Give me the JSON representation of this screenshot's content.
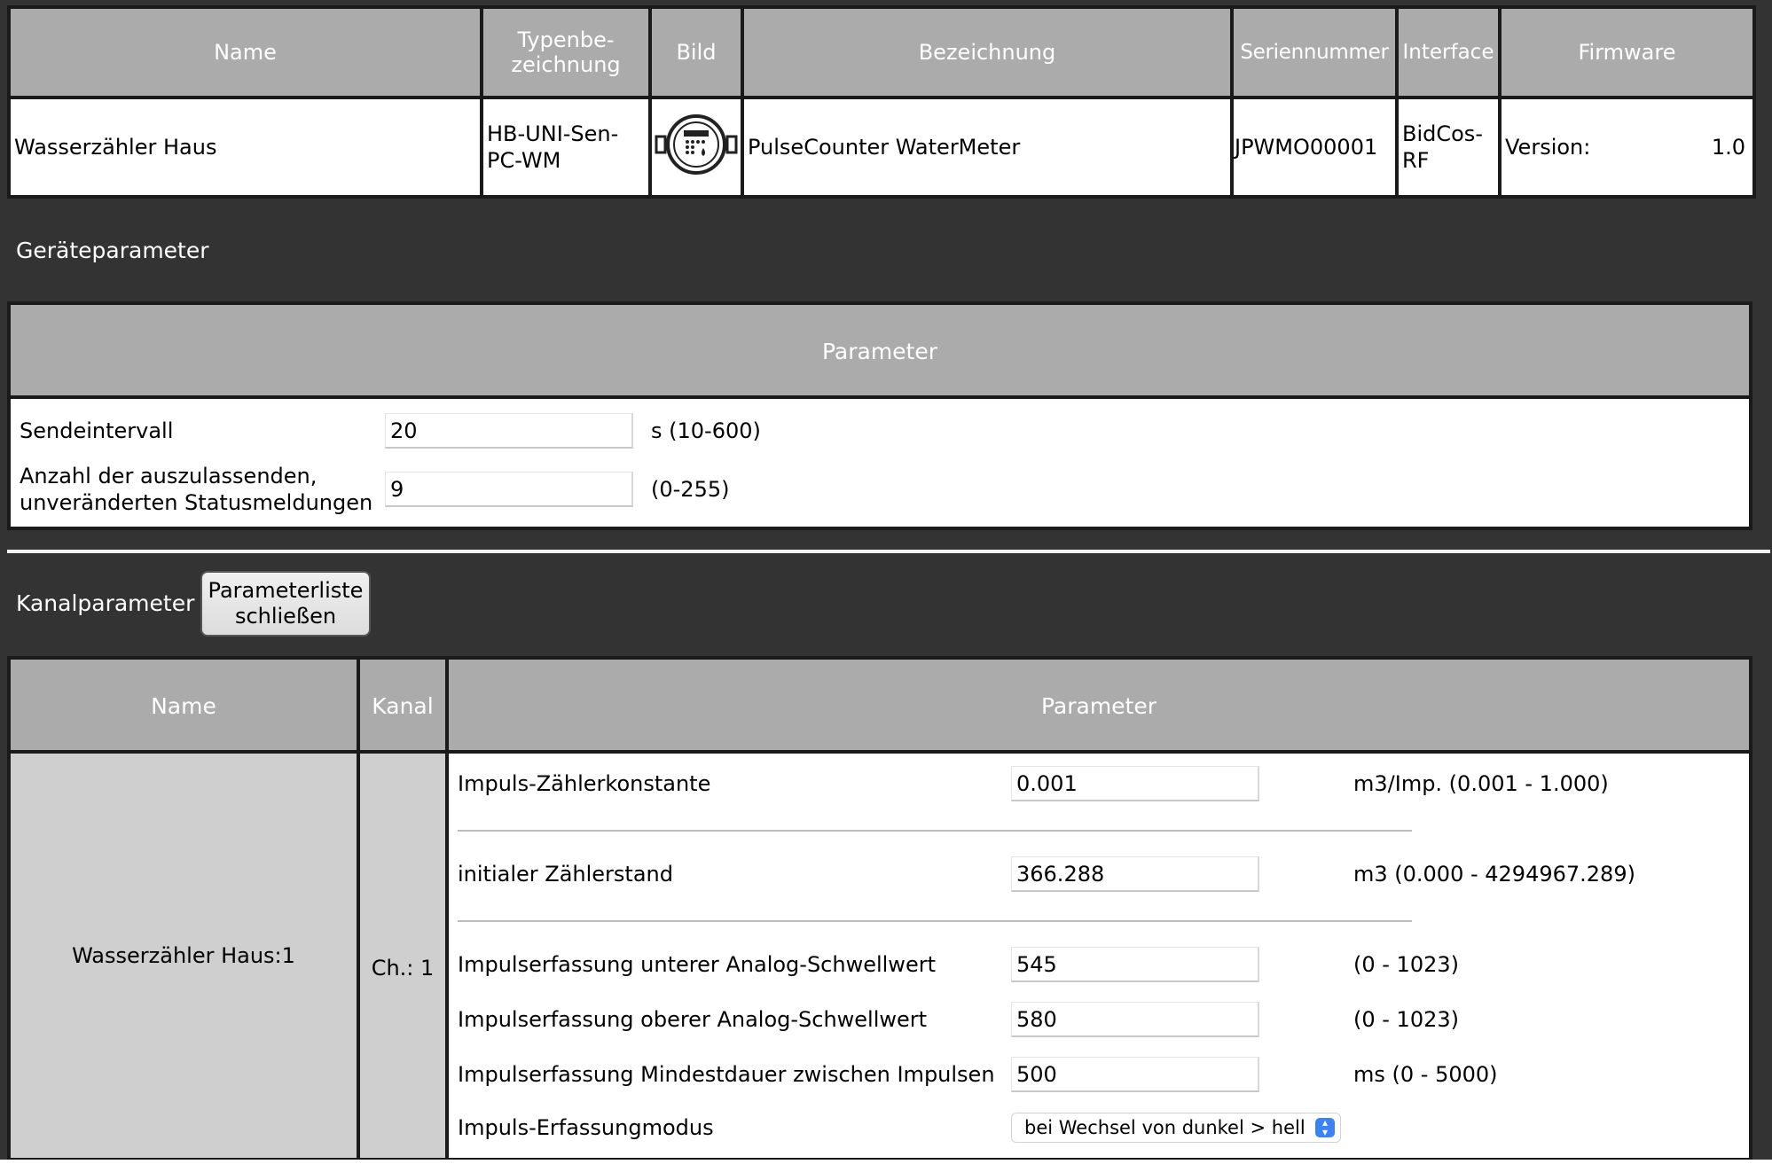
{
  "device_table": {
    "headers": {
      "name": "Name",
      "type_line1": "Typenbe-",
      "type_line2": "zeichnung",
      "image": "Bild",
      "description": "Bezeichnung",
      "serial": "Seriennummer",
      "interface": "Interface",
      "firmware": "Firmware"
    },
    "row": {
      "name": "Wasserzähler Haus",
      "type_line1": "HB-UNI-Sen-",
      "type_line2": "PC-WM",
      "image_icon": "water-meter-icon",
      "description": "PulseCounter WaterMeter",
      "serial": "JPWMO00001",
      "interface_line1": "BidCos-",
      "interface_line2": "RF",
      "firmware_label": "Version:",
      "firmware_value": "1.0"
    }
  },
  "device_params": {
    "section_title": "Geräteparameter",
    "header": "Parameter",
    "rows": [
      {
        "label": "Sendeintervall",
        "value": "20",
        "unit": "s (10-600)"
      },
      {
        "label_line1": "Anzahl der auszulassenden,",
        "label_line2": "unveränderten Statusmeldungen",
        "value": "9",
        "unit": "(0-255)"
      }
    ]
  },
  "channel_params": {
    "section_title": "Kanalparameter",
    "close_button_line1": "Parameterliste",
    "close_button_line2": "schließen",
    "headers": {
      "name": "Name",
      "channel": "Kanal",
      "parameter": "Parameter"
    },
    "channel_name": "Wasserzähler Haus:1",
    "channel_id": "Ch.: 1",
    "rows": [
      {
        "label": "Impuls-Zählerkonstante",
        "value": "0.001",
        "unit": "m3/Imp. (0.001 - 1.000)"
      },
      {
        "label": "initialer Zählerstand",
        "value": "366.288",
        "unit": "m3 (0.000 - 4294967.289)"
      },
      {
        "label": "Impulserfassung unterer Analog-Schwellwert",
        "value": "545",
        "unit": "(0 - 1023)"
      },
      {
        "label": "Impulserfassung oberer Analog-Schwellwert",
        "value": "580",
        "unit": "(0 - 1023)"
      },
      {
        "label": "Impulserfassung Mindestdauer zwischen Impulsen",
        "value": "500",
        "unit": "ms (0 - 5000)"
      }
    ],
    "mode": {
      "label": "Impuls-Erfassungmodus",
      "selected": "bei Wechsel von dunkel > hell"
    }
  },
  "colors": {
    "background": "#333333",
    "header_gray": "#ababab",
    "cell_gray": "#cfcfcf",
    "select_accent": "#3b82f6"
  }
}
